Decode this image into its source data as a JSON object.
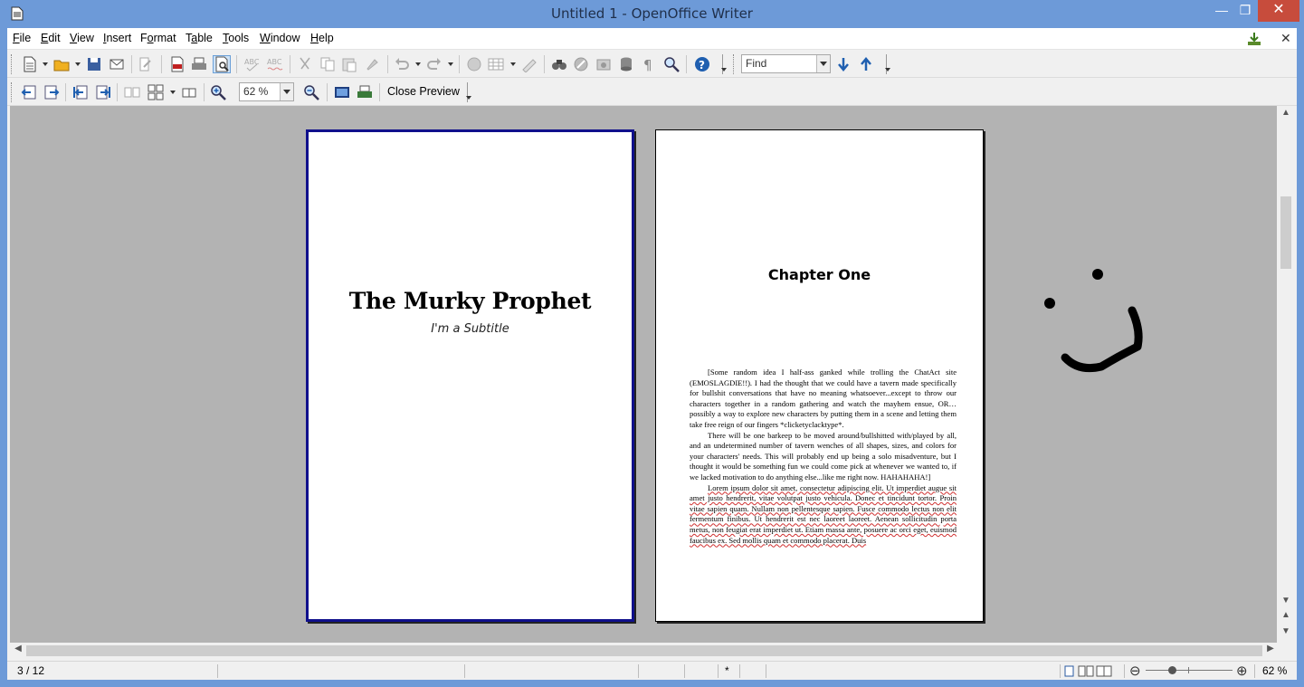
{
  "window": {
    "title": "Untitled 1 - OpenOffice Writer"
  },
  "menu": {
    "file": "File",
    "edit": "Edit",
    "view": "View",
    "insert": "Insert",
    "format": "Format",
    "table": "Table",
    "tools": "Tools",
    "window": "Window",
    "help": "Help",
    "file_key": "F",
    "edit_key": "E",
    "view_key": "V",
    "insert_key": "I",
    "format_key": "o",
    "table_key": "a",
    "tools_key": "T",
    "window_key": "W",
    "help_key": "H"
  },
  "toolbar": {
    "find_placeholder": "Find"
  },
  "preview_toolbar": {
    "zoom_value": "62 %",
    "close_preview_label": "Close Preview"
  },
  "document": {
    "title_page": {
      "title": "The Murky Prophet",
      "subtitle": "I'm a Subtitle"
    },
    "chapter_page": {
      "heading": "Chapter One",
      "paragraphs": [
        "[Some random idea I half-ass ganked while trolling the ChatAct site (EMOSLAGDIE!!). I had the thought that we could have a tavern made specifically for bullshit conversations that have no meaning whatsoever...except to throw our characters together in a random gathering and watch the mayhem ensue, OR…possibly a way to explore new characters by putting them in a scene and letting them take free reign of our fingers *clicketyclacktype*.",
        "There will be one barkeep to be moved around/bullshitted with/played by all, and an undetermined number of tavern wenches of all shapes, sizes, and colors for your characters' needs. This will probably end up being a solo misadventure, but I thought it would be something fun we could come pick at whenever we wanted to, if we lacked motivation to do anything else...like me right now. HAHAHAHA!]",
        "Lorem ipsum dolor sit amet, consectetur adipiscing elit. Ut imperdiet augue sit amet justo hendrerit, vitae volutpat justo vehicula. Donec et tincidunt tortor. Proin vitae sapien quam. Nullam non pellentesque sapien. Fusce commodo lectus non elit fermentum finibus. Ut hendrerit est nec laoreet laoreet. Aenean sollicitudin porta metus, non feugiat erat imperdiet ut. Etiam massa ante, posuere ac orci eget, euismod faucibus ex. Sed mollis quam et commodo placerat. Duis"
      ]
    }
  },
  "status": {
    "page": "3 / 12",
    "modified": "*",
    "zoom": "62 %"
  },
  "zoom_slider": {
    "level_fraction": 0.3
  }
}
